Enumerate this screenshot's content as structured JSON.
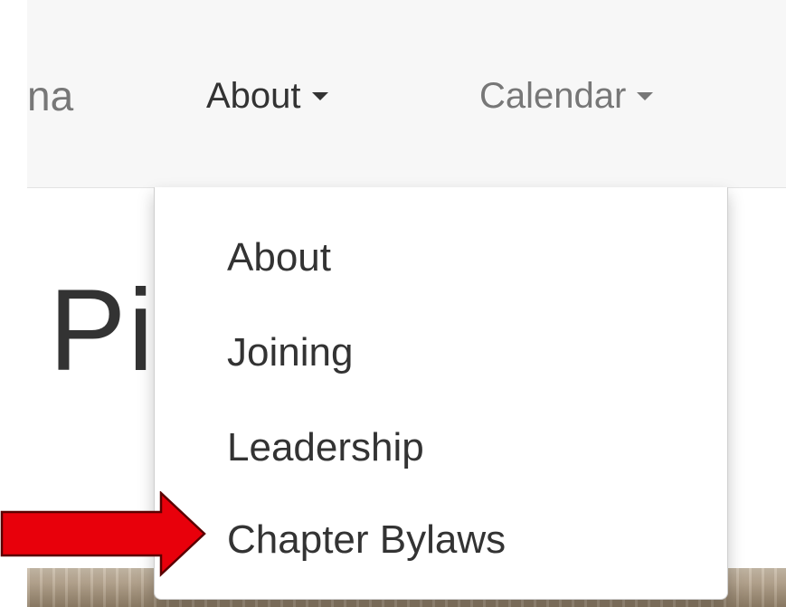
{
  "navbar": {
    "brand_partial": "na",
    "items": [
      {
        "label": "About",
        "active": true
      },
      {
        "label": "Calendar",
        "active": false
      }
    ]
  },
  "page": {
    "heading_partial": "Pi                     n"
  },
  "dropdown": {
    "items": [
      {
        "label": "About"
      },
      {
        "label": "Joining"
      },
      {
        "label": "Leadership"
      },
      {
        "label": "Chapter Bylaws"
      }
    ]
  },
  "colors": {
    "navbar_bg": "#f7f7f7",
    "text_dark": "#333333",
    "text_muted": "#777777",
    "annotation_arrow": "#e8000b"
  },
  "icons": {
    "caret": "caret-down-icon",
    "annotation": "red-arrow-icon"
  }
}
